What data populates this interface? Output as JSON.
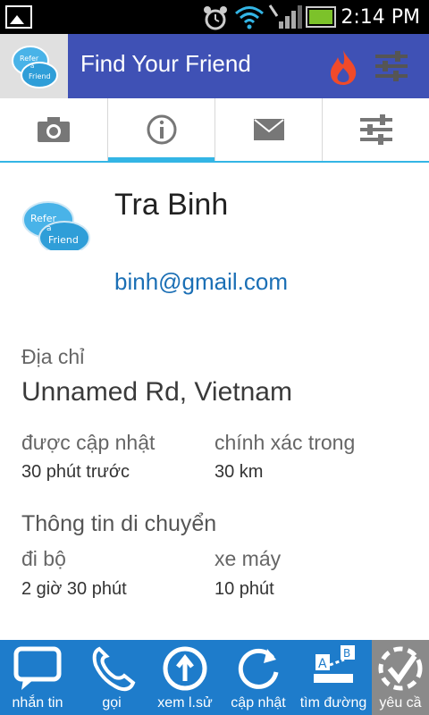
{
  "status_bar": {
    "time": "2:14 PM"
  },
  "app_bar": {
    "title": "Find Your Friend",
    "logo_text": [
      "Refer",
      "a",
      "Friend"
    ]
  },
  "tabs": [
    {
      "icon": "camera-icon"
    },
    {
      "icon": "info-icon",
      "active": true
    },
    {
      "icon": "mail-icon"
    },
    {
      "icon": "sliders-icon"
    }
  ],
  "profile": {
    "name": "Tra Binh",
    "email": "binh@gmail.com"
  },
  "address": {
    "label": "Địa chỉ",
    "value": "Unnamed Rd, Vietnam"
  },
  "updated": {
    "label": "được cập nhật",
    "value": "30 phút trước"
  },
  "accuracy": {
    "label": "chính xác trong",
    "value": "30 km"
  },
  "travel": {
    "label": "Thông tin di chuyển",
    "walk": {
      "label": "đi bộ",
      "value": "2 giờ 30 phút"
    },
    "motorbike": {
      "label": "xe máy",
      "value": "10 phút"
    }
  },
  "bottom_bar": {
    "message": "nhắn tin",
    "call": "gọi",
    "history": "xem l.sử",
    "update": "cập nhật",
    "directions": "tìm đường",
    "request": "yêu cầ"
  },
  "colors": {
    "app_bar": "#3f51b5",
    "tab_indicator": "#33b5e5",
    "bottom_bar": "#1e7ccb",
    "link": "#1b6fb5"
  }
}
